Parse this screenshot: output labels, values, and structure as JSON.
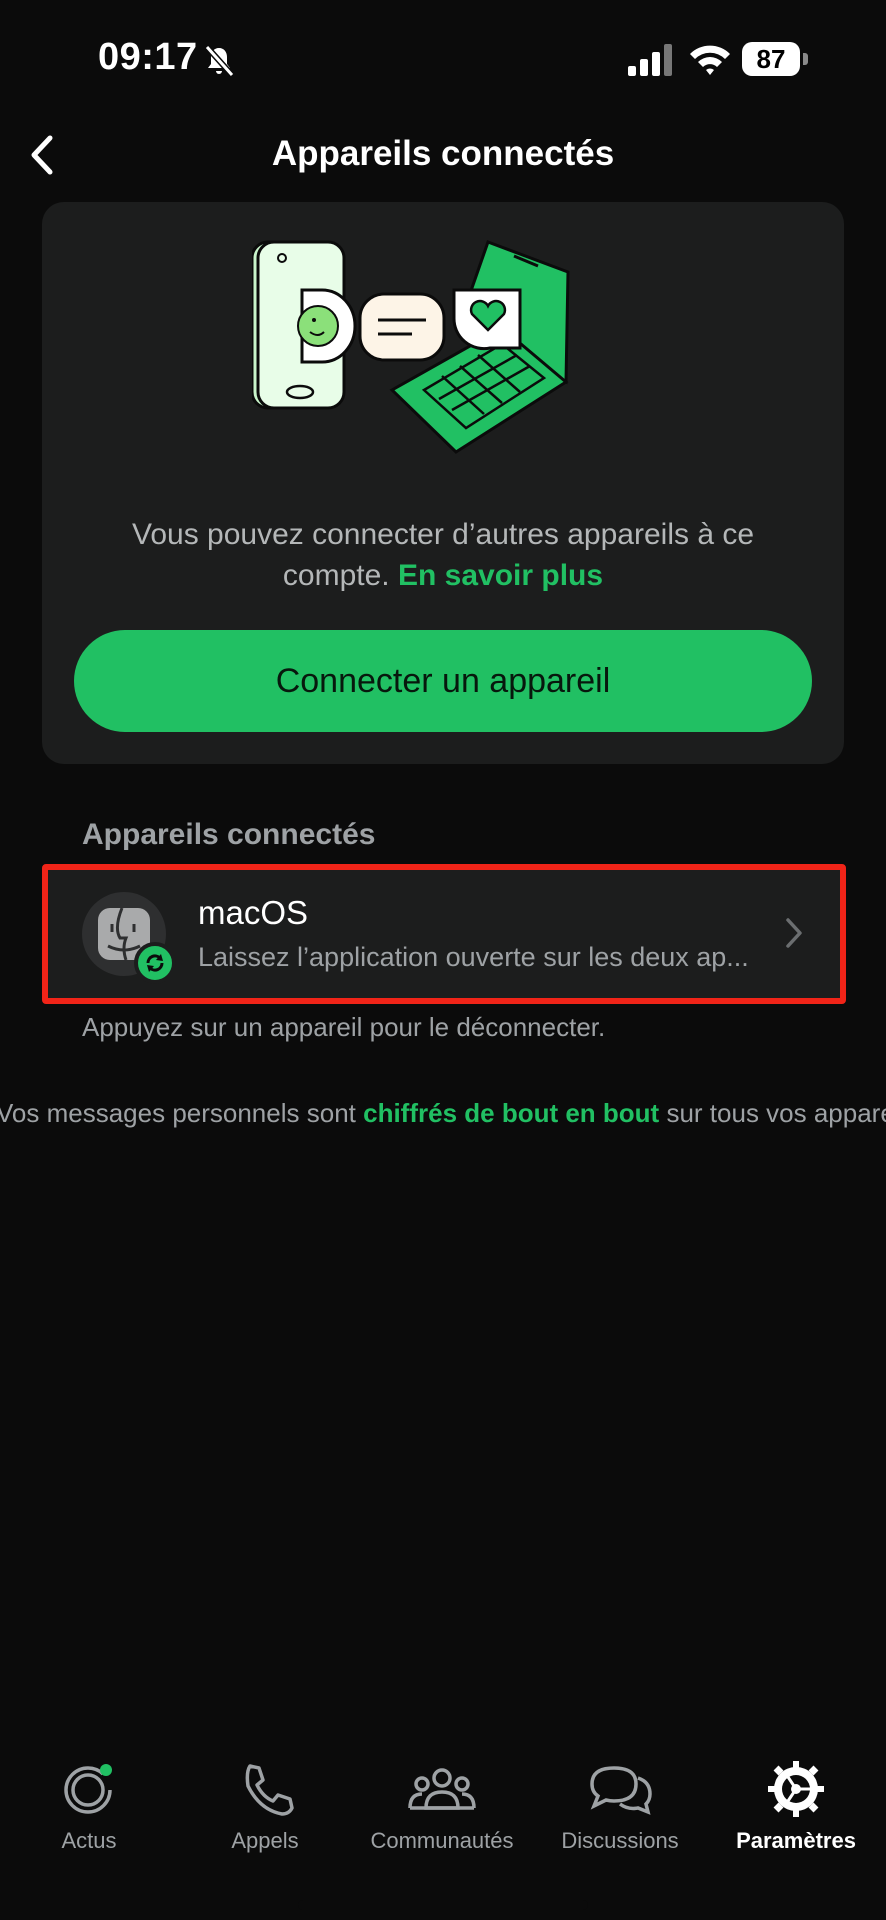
{
  "status_bar": {
    "time": "09:17",
    "battery": "87"
  },
  "header": {
    "title": "Appareils connectés"
  },
  "card": {
    "description": "Vous pouvez connecter d’autres appareils à ce compte.",
    "learn_more": "En savoir plus",
    "cta_label": "Connecter un appareil"
  },
  "section_title": "Appareils connectés",
  "device": {
    "name": "macOS",
    "subtitle": "Laissez l’application ouverte sur les deux ap..."
  },
  "hint": "Appuyez sur un appareil pour le déconnecter.",
  "e2e": {
    "prefix": "Vos messages personnels sont",
    "link": "chiffrés de bout en bout",
    "suffix": "sur tous vos appare"
  },
  "tabs": [
    {
      "label": "Actus",
      "icon": "updates-icon"
    },
    {
      "label": "Appels",
      "icon": "phone-icon"
    },
    {
      "label": "Communautés",
      "icon": "communities-icon"
    },
    {
      "label": "Discussions",
      "icon": "chats-icon"
    },
    {
      "label": "Paramètres",
      "icon": "settings-icon",
      "active": true
    }
  ],
  "colors": {
    "accent": "#21c063",
    "background": "#0b0b0b",
    "card": "#1c1d1d",
    "highlight": "#f12418"
  }
}
